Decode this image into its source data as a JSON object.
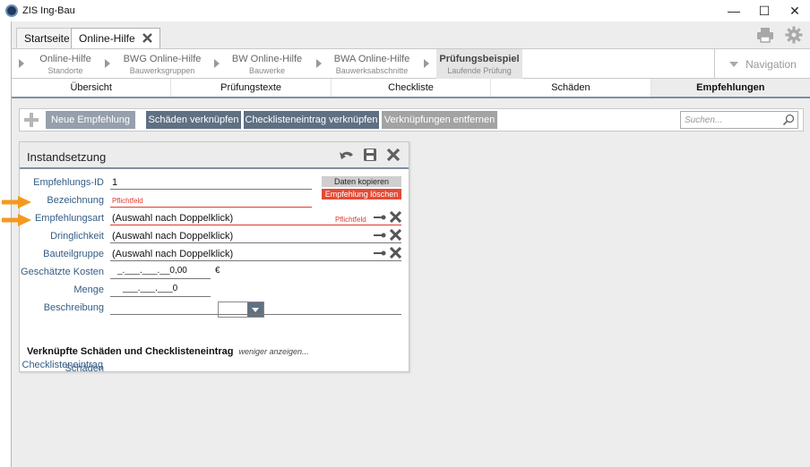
{
  "app": {
    "title": "ZIS Ing-Bau"
  },
  "window_controls": {
    "minimize": "—",
    "maximize": "☐",
    "close": "✕"
  },
  "tabs": [
    {
      "label": "Startseite"
    },
    {
      "label": "Online-Hilfe"
    }
  ],
  "breadcrumb": [
    {
      "title": "Online-Hilfe",
      "subtitle": "Standorte"
    },
    {
      "title": "BWG Online-Hilfe",
      "subtitle": "Bauwerksgruppen"
    },
    {
      "title": "BW Online-Hilfe",
      "subtitle": "Bauwerke"
    },
    {
      "title": "BWA Online-Hilfe",
      "subtitle": "Bauwerksabschnitte"
    },
    {
      "title": "Prüfungsbeispiel",
      "subtitle": "Laufende Prüfung"
    }
  ],
  "navigation": {
    "label": "Navigation"
  },
  "section_tabs": [
    {
      "label": "Übersicht"
    },
    {
      "label": "Prüfungstexte"
    },
    {
      "label": "Checkliste"
    },
    {
      "label": "Schäden"
    },
    {
      "label": "Empfehlungen"
    }
  ],
  "toolbar": {
    "new_label": "Neue Empfehlung",
    "link_damage_label": "Schäden verknüpfen",
    "link_checklist_label": "Checklisteneintrag verknüpfen",
    "remove_links_label": "Verknüpfungen entfernen",
    "search_placeholder": "Suchen..."
  },
  "panel": {
    "title": "Instandsetzung",
    "copy_label": "Daten kopieren",
    "delete_label": "Empfehlung löschen",
    "required_text": "Pflichtfeld",
    "fields": {
      "id": {
        "label": "Empfehlungs-ID",
        "value": "1"
      },
      "bezeichnung": {
        "label": "Bezeichnung",
        "value": ""
      },
      "art": {
        "label": "Empfehlungsart",
        "value": "(Auswahl nach Doppelklick)"
      },
      "dringlichkeit": {
        "label": "Dringlichkeit",
        "value": "(Auswahl nach Doppelklick)"
      },
      "bauteilgruppe": {
        "label": "Bauteilgruppe",
        "value": "(Auswahl nach Doppelklick)"
      },
      "kosten": {
        "label": "Geschätzte Kosten",
        "value": "_.___.___.__0,00",
        "unit": "€"
      },
      "menge": {
        "label": "Menge",
        "value": "___.___.___0"
      },
      "beschreibung": {
        "label": "Beschreibung",
        "value": ""
      }
    },
    "linked_section": {
      "title": "Verknüpfte Schäden und Checklisteneintrag",
      "toggle": "weniger anzeigen...",
      "schaeden_label": "Schäden",
      "checkliste_label": "Checklisteneintrag"
    }
  },
  "colors": {
    "accent": "#5f7083",
    "tab_line": "#7f8fa3",
    "label_blue": "#335c85",
    "required_red": "#e03a2f",
    "arrow_orange": "#f39a1e"
  }
}
